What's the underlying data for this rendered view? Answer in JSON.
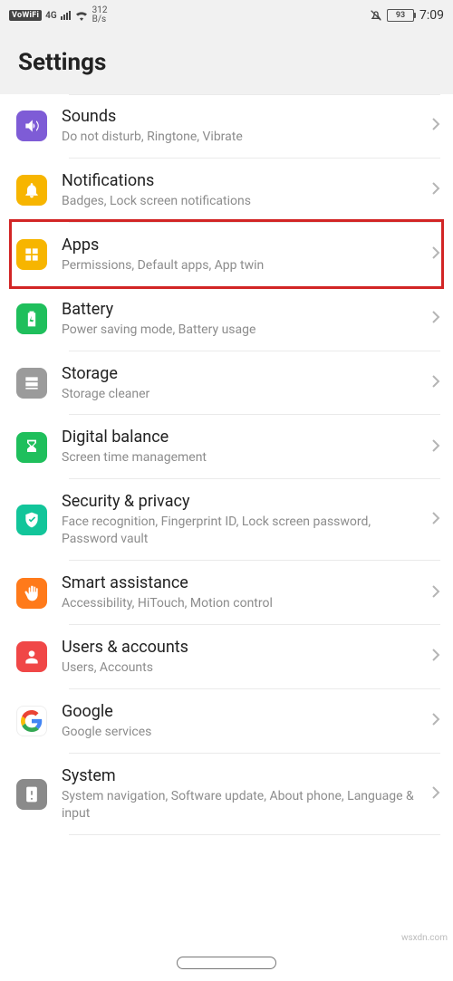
{
  "status": {
    "vowifi": "VoWiFi",
    "net_gen": "4G",
    "rate_top": "312",
    "rate_bot": "B/s",
    "battery_pct": "93",
    "time": "7:09"
  },
  "header": {
    "title": "Settings"
  },
  "rows": [
    {
      "key": "sounds",
      "title": "Sounds",
      "sub": "Do not disturb, Ringtone, Vibrate",
      "icon": "sounds",
      "color": "bg-purple"
    },
    {
      "key": "notifications",
      "title": "Notifications",
      "sub": "Badges, Lock screen notifications",
      "icon": "bell",
      "color": "bg-yellow"
    },
    {
      "key": "apps",
      "title": "Apps",
      "sub": "Permissions, Default apps, App twin",
      "icon": "apps",
      "color": "bg-yellow",
      "highlighted": true
    },
    {
      "key": "battery",
      "title": "Battery",
      "sub": "Power saving mode, Battery usage",
      "icon": "battery",
      "color": "bg-green"
    },
    {
      "key": "storage",
      "title": "Storage",
      "sub": "Storage cleaner",
      "icon": "storage",
      "color": "bg-grey"
    },
    {
      "key": "digital",
      "title": "Digital balance",
      "sub": "Screen time management",
      "icon": "hourglass",
      "color": "bg-green"
    },
    {
      "key": "security",
      "title": "Security & privacy",
      "sub": "Face recognition, Fingerprint ID, Lock screen password, Password vault",
      "icon": "shield",
      "color": "bg-teal"
    },
    {
      "key": "smart",
      "title": "Smart assistance",
      "sub": "Accessibility, HiTouch, Motion control",
      "icon": "hand",
      "color": "bg-orange"
    },
    {
      "key": "users",
      "title": "Users & accounts",
      "sub": "Users, Accounts",
      "icon": "user",
      "color": "bg-red"
    },
    {
      "key": "google",
      "title": "Google",
      "sub": "Google services",
      "icon": "google",
      "color": "google"
    },
    {
      "key": "system",
      "title": "System",
      "sub": "System navigation, Software update, About phone, Language & input",
      "icon": "system",
      "color": "bg-greydark"
    }
  ],
  "watermark": "wsxdn.com"
}
